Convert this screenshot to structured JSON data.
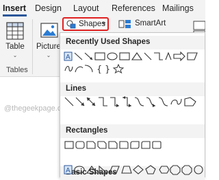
{
  "tabs": [
    "Insert",
    "Design",
    "Layout",
    "References",
    "Mailings"
  ],
  "ribbon": {
    "table_label": "Table",
    "tables_group_label": "Tables",
    "pictures_label": "Pictures",
    "shapes_label": "Shapes",
    "smartart_label": "SmartArt"
  },
  "shapes_menu": {
    "sections": [
      "Recently Used Shapes",
      "Lines",
      "Rectangles",
      "Basic Shapes"
    ]
  },
  "watermark": "@thegeekpage.com",
  "colors": {
    "highlight": "#e02020",
    "accent": "#2b579a",
    "ribbon_bg": "#f3f3f3"
  }
}
